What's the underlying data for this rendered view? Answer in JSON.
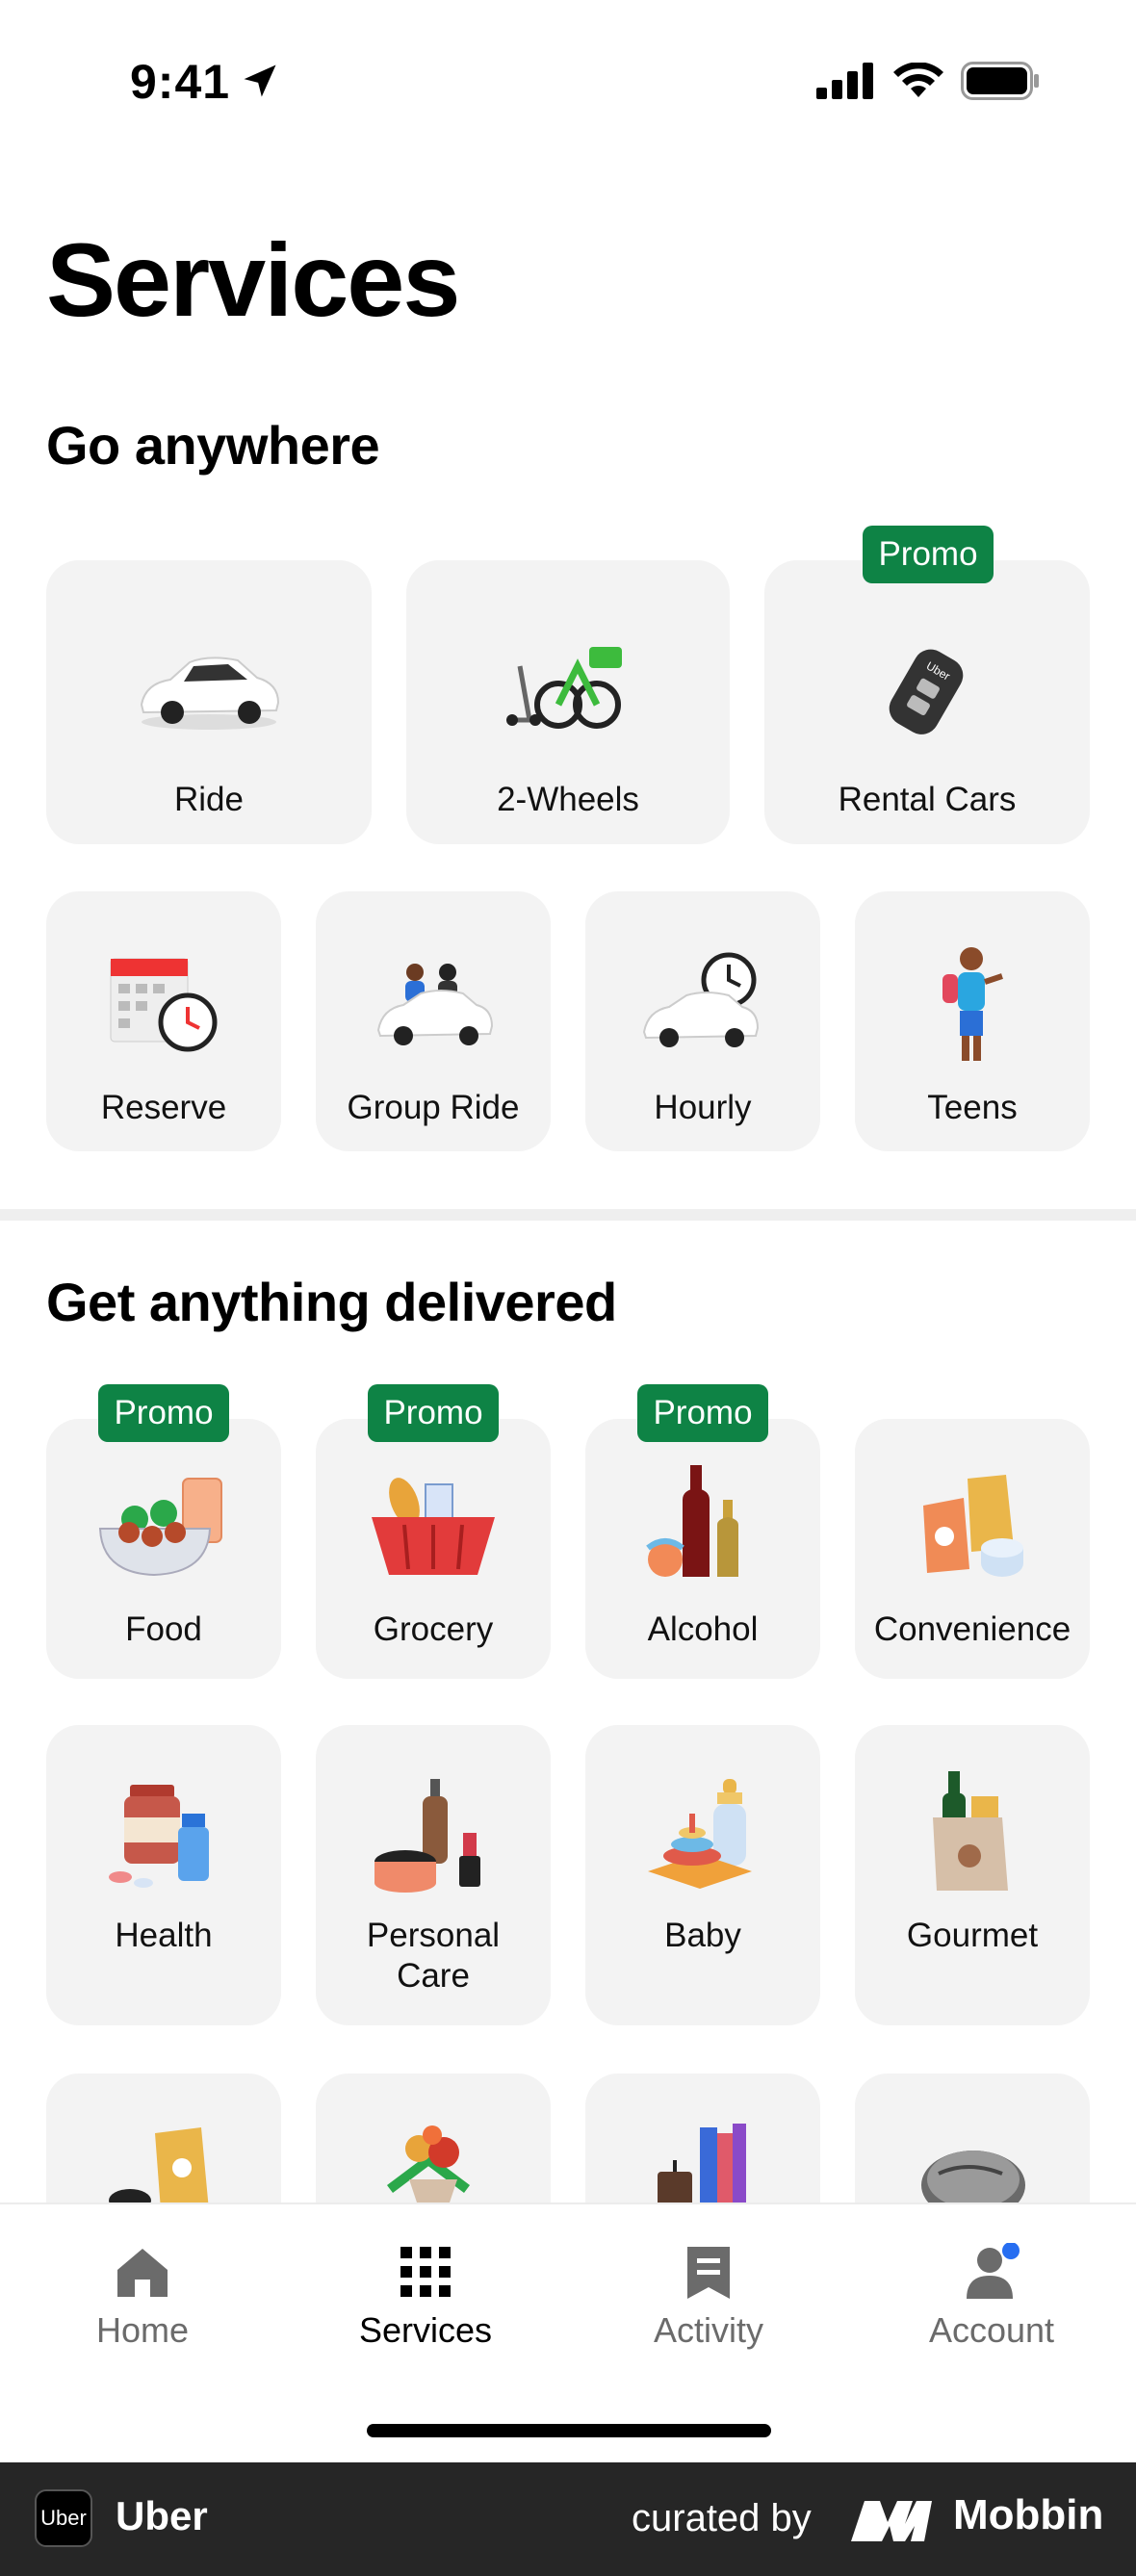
{
  "status": {
    "time": "9:41"
  },
  "page": {
    "title": "Services"
  },
  "sections": {
    "go": {
      "title": "Go anywhere"
    },
    "delivered": {
      "title": "Get anything delivered"
    }
  },
  "go_row1": [
    {
      "label": "Ride",
      "promo": ""
    },
    {
      "label": "2-Wheels",
      "promo": ""
    },
    {
      "label": "Rental Cars",
      "promo": "Promo"
    }
  ],
  "go_row2": [
    {
      "label": "Reserve"
    },
    {
      "label": "Group Ride"
    },
    {
      "label": "Hourly"
    },
    {
      "label": "Teens"
    }
  ],
  "deliv_row1": [
    {
      "label": "Food",
      "promo": "Promo"
    },
    {
      "label": "Grocery",
      "promo": "Promo"
    },
    {
      "label": "Alcohol",
      "promo": "Promo"
    },
    {
      "label": "Convenience",
      "promo": ""
    }
  ],
  "deliv_row2": [
    {
      "label": "Health"
    },
    {
      "label": "Personal",
      "label2": "Care"
    },
    {
      "label": "Baby"
    },
    {
      "label": "Gourmet"
    }
  ],
  "nav": [
    {
      "label": "Home",
      "icon": "home-icon"
    },
    {
      "label": "Services",
      "icon": "grid-icon"
    },
    {
      "label": "Activity",
      "icon": "receipt-icon"
    },
    {
      "label": "Account",
      "icon": "person-icon"
    }
  ],
  "footer": {
    "logo": "Uber",
    "app": "Uber",
    "curated": "curated by",
    "brand": "Mobbin"
  },
  "colors": {
    "promo": "#0e8345",
    "tile": "#f3f3f3",
    "badge_dot": "#276ef1"
  }
}
